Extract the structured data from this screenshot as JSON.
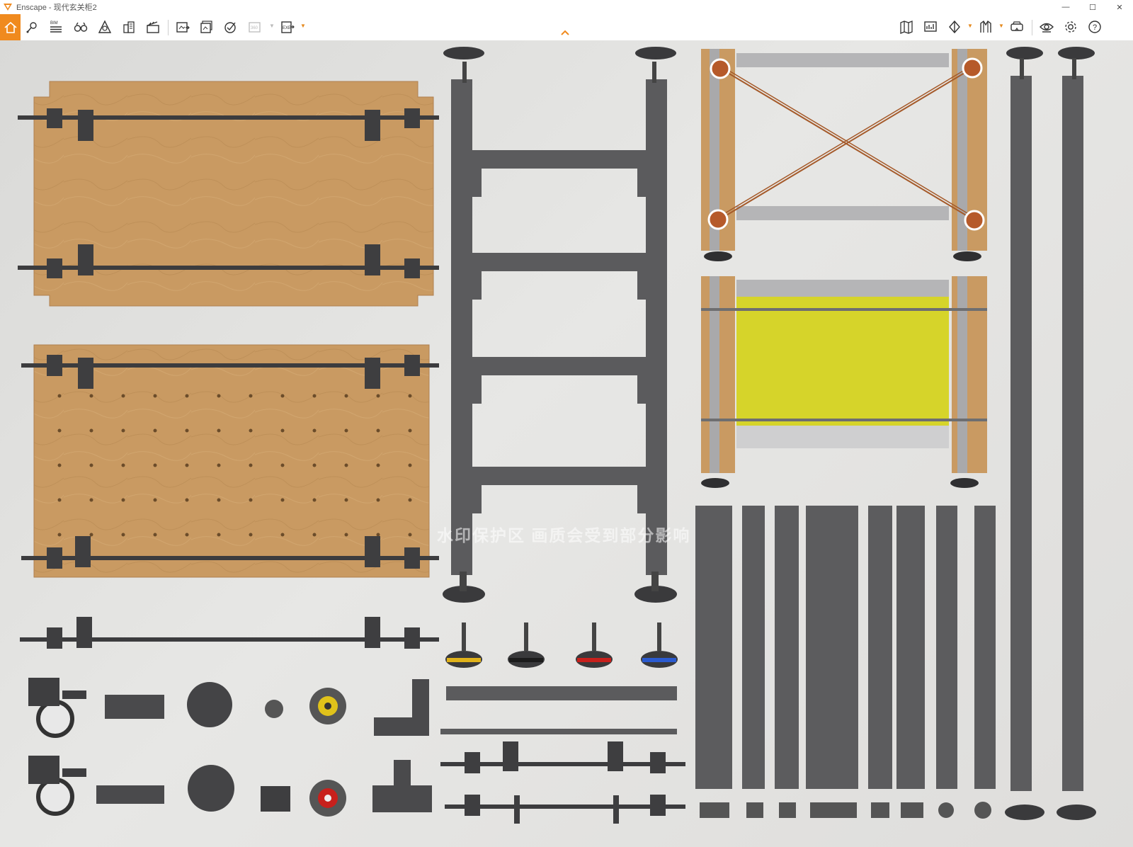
{
  "window": {
    "title": "Enscape - 现代玄关柜2"
  },
  "toolbar": {
    "bim_label": "BIM",
    "label_360": "360",
    "exe_label": "EXE"
  },
  "viewport": {
    "watermark": "水印保护区  画质会受到部分影响"
  },
  "colors": {
    "accent": "#f08a1e",
    "plywood": "#c99a62",
    "metal": "#5b5b5d",
    "panel_yellow": "#d6d42a"
  }
}
